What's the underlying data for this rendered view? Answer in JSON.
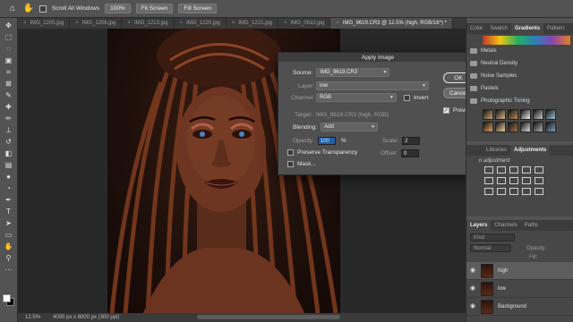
{
  "options_bar": {
    "home_icon": "home-icon",
    "hand_icon": "hand-icon",
    "scroll_all": "Scroll All Windows",
    "zoom": "100%",
    "fit_screen": "Fit Screen",
    "fill_screen": "Fill Screen"
  },
  "tabs": [
    {
      "label": "IMG_1205.jpg"
    },
    {
      "label": "IMG_1206.jpg"
    },
    {
      "label": "IMG_1213.jpg"
    },
    {
      "label": "IMG_1220.jpg"
    },
    {
      "label": "IMG_1221.jpg"
    },
    {
      "label": "IMG_0610.jpg"
    },
    {
      "label": "IMG_9619.CR3 @ 12.5% (high, RGB/16*) *"
    }
  ],
  "status": {
    "zoom": "12.5%",
    "dimensions": "4000 px x 6000 px (300 ppi)"
  },
  "dialog": {
    "title": "Apply Image",
    "source_label": "Source:",
    "source_value": "IMG_9619.CR3",
    "layer_label": "Layer:",
    "layer_value": "low",
    "channel_label": "Channel:",
    "channel_value": "RGB",
    "invert_label": "Invert",
    "target_label": "Target:",
    "target_value": "IMG_9619.CR3 (high, RGB)",
    "blending_label": "Blending:",
    "blending_value": "Add",
    "opacity_label": "Opacity:",
    "opacity_value": "100",
    "percent": "%",
    "scale_label": "Scale:",
    "scale_value": "2",
    "preserve_label": "Preserve Transparency",
    "offset_label": "Offset:",
    "offset_value": "0",
    "mask_label": "Mask...",
    "ok_label": "OK",
    "cancel_label": "Cancel",
    "preview_label": "Preview"
  },
  "gradients_panel": {
    "tabs": [
      "Color",
      "Swatch",
      "Gradients",
      "Pattern"
    ],
    "groups": [
      "Metals",
      "Neutral Density",
      "Noise Samples",
      "Pastels",
      "Photographic Toning"
    ]
  },
  "adjustments_panel": {
    "tabs": [
      "Libraries",
      "Adjustments"
    ],
    "hint": "n adjustment"
  },
  "layers_panel": {
    "tabs": [
      "Layers",
      "Channels",
      "Paths"
    ],
    "filter_placeholder": "Kind",
    "blend_mode": "Normal",
    "opacity_label": "Opacity:",
    "fill_label": "Fill:",
    "layers": [
      {
        "name": "high"
      },
      {
        "name": "low"
      },
      {
        "name": "Background"
      }
    ]
  }
}
